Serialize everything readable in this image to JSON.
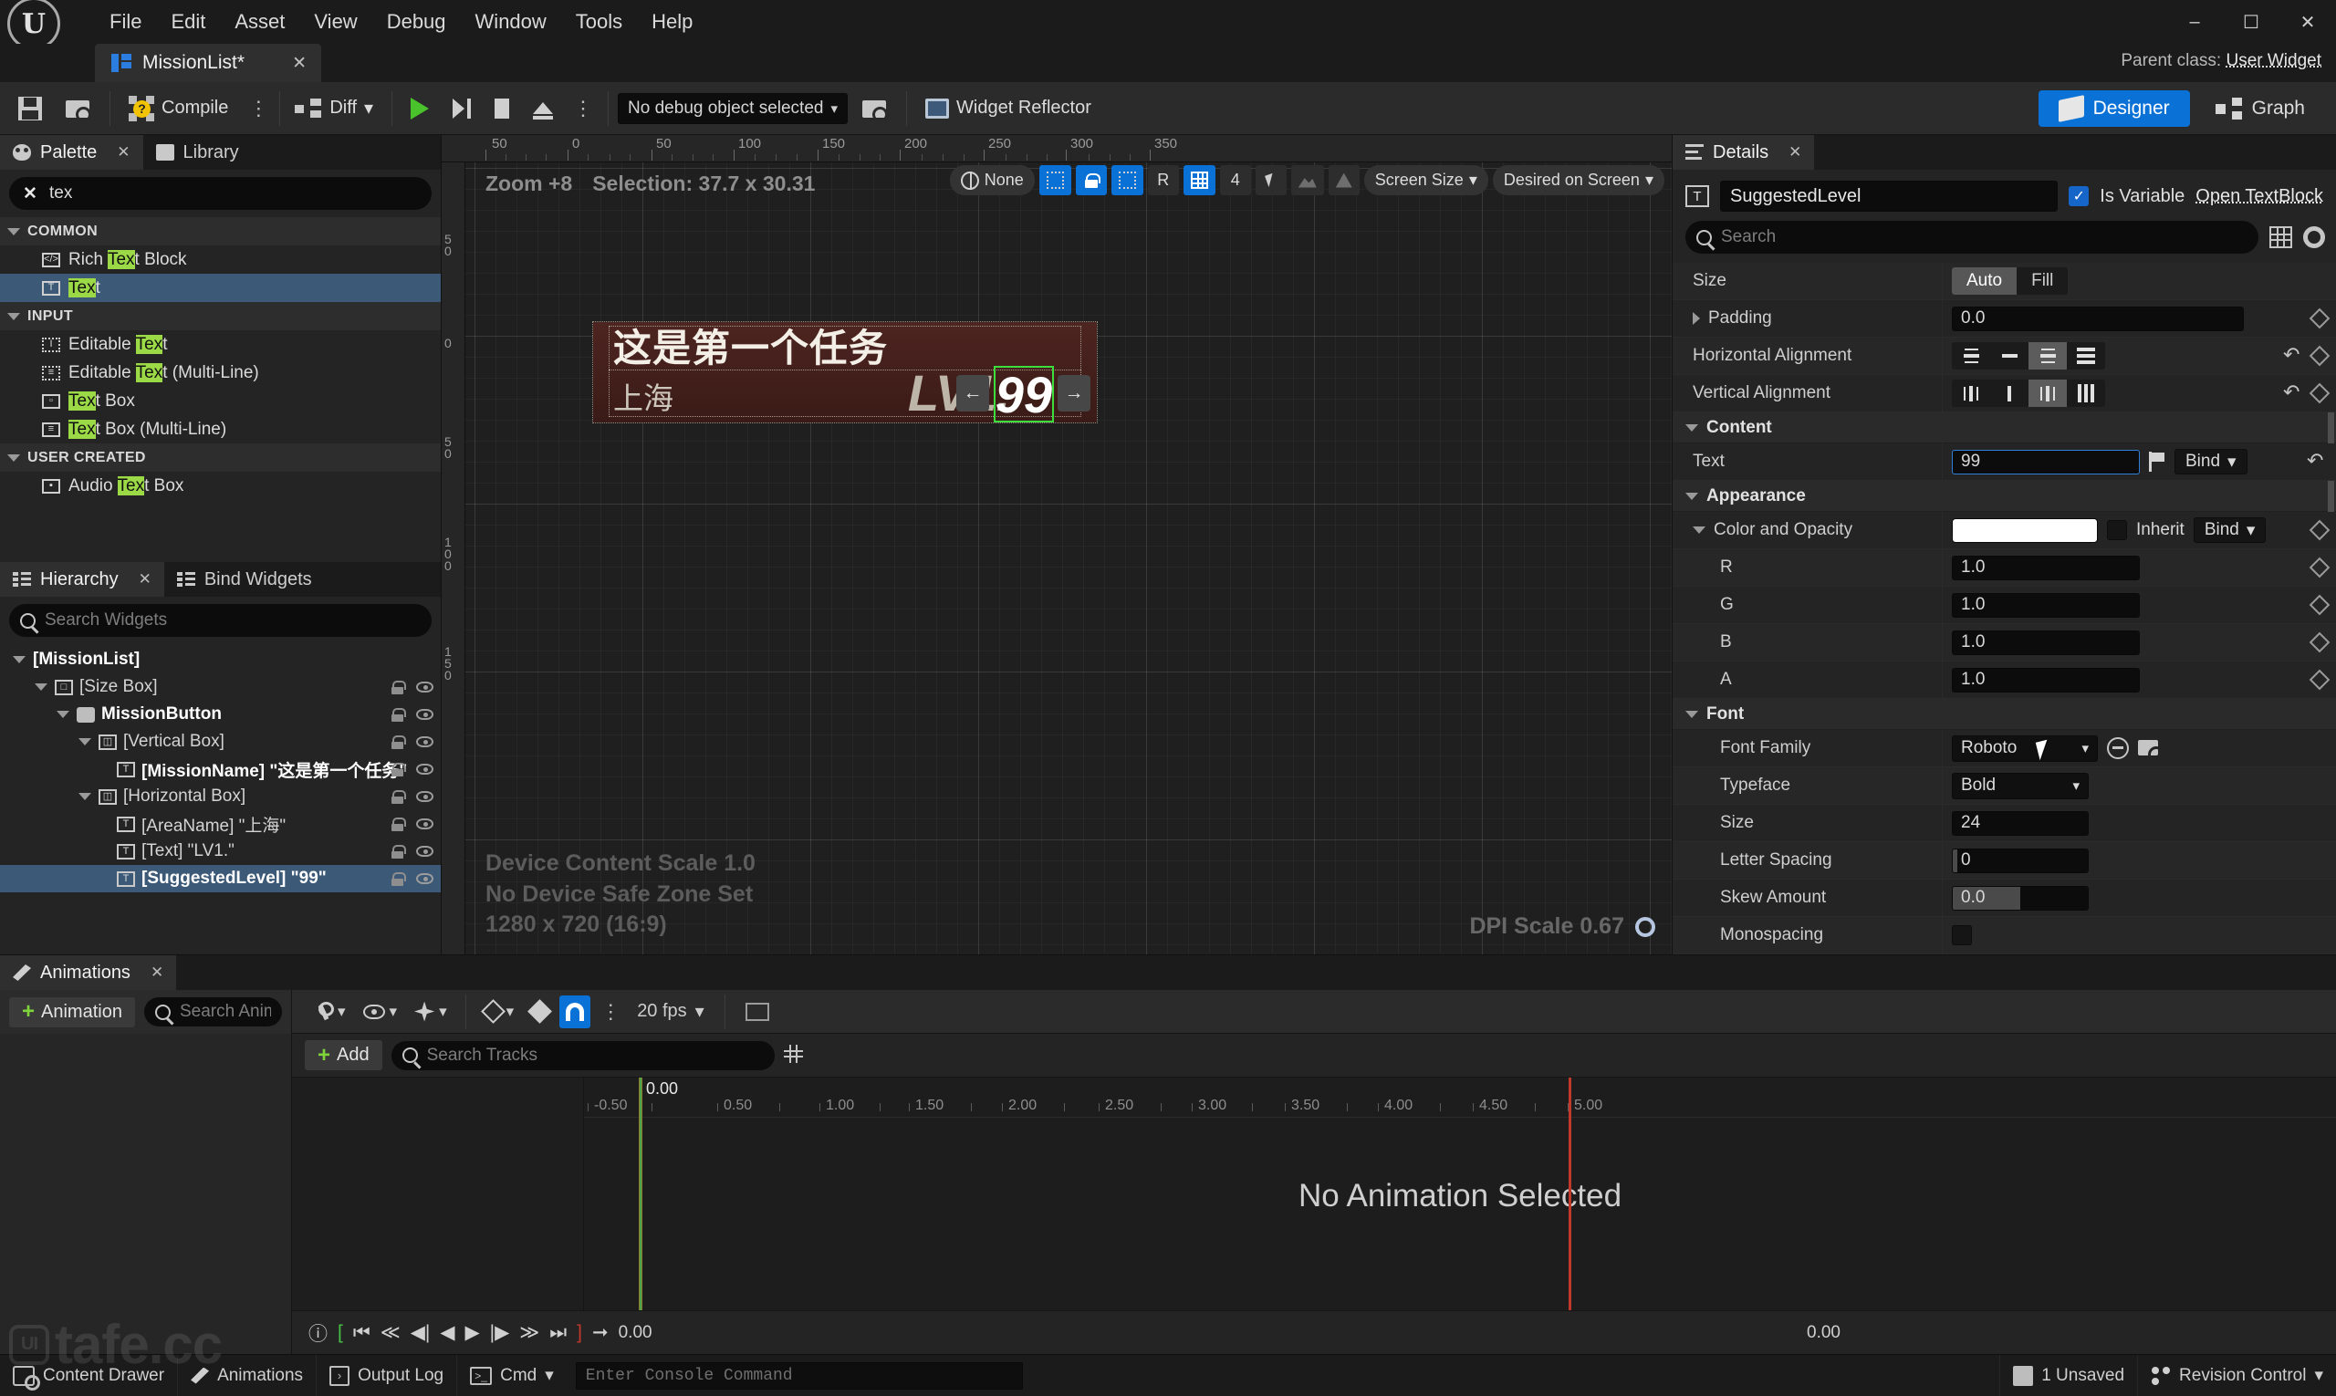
{
  "window": {
    "title": "MissionList*",
    "parent_class_label": "Parent class:",
    "parent_class_value": "User Widget",
    "controls": {
      "minimize": "–",
      "maximize": "☐",
      "close": "✕"
    }
  },
  "menubar": {
    "items": [
      "File",
      "Edit",
      "Asset",
      "View",
      "Debug",
      "Window",
      "Tools",
      "Help"
    ]
  },
  "toolbar": {
    "save_tooltip": "Save",
    "browse_tooltip": "Browse",
    "compile_label": "Compile",
    "diff_label": "Diff",
    "debug_object": "No debug object selected",
    "widget_reflector": "Widget Reflector",
    "mode_designer": "Designer",
    "mode_graph": "Graph"
  },
  "palette": {
    "tab_label": "Palette",
    "library_tab_label": "Library",
    "search_value": "tex",
    "categories": [
      {
        "name": "COMMON",
        "items": [
          {
            "pre": "Rich ",
            "match": "Tex",
            "post": "t Block",
            "icon": "rich-text-icon",
            "selected": false
          },
          {
            "pre": "",
            "match": "Tex",
            "post": "t",
            "icon": "text-icon",
            "selected": true
          }
        ]
      },
      {
        "name": "INPUT",
        "items": [
          {
            "pre": "Editable ",
            "match": "Tex",
            "post": "t",
            "icon": "editable-text-icon",
            "selected": false
          },
          {
            "pre": "Editable ",
            "match": "Tex",
            "post": "t (Multi-Line)",
            "icon": "editable-text-multiline-icon",
            "selected": false
          },
          {
            "pre": "",
            "match": "Tex",
            "post": "t Box",
            "icon": "text-box-icon",
            "selected": false
          },
          {
            "pre": "",
            "match": "Tex",
            "post": "t Box (Multi-Line)",
            "icon": "text-box-multiline-icon",
            "selected": false
          }
        ]
      },
      {
        "name": "USER CREATED",
        "items": [
          {
            "pre": "Audio ",
            "match": "Tex",
            "post": "t Box",
            "icon": "audio-text-box-icon",
            "selected": false
          }
        ]
      }
    ]
  },
  "hierarchy": {
    "tab_label": "Hierarchy",
    "bind_widgets_tab_label": "Bind Widgets",
    "search_placeholder": "Search Widgets",
    "nodes": [
      {
        "depth": 0,
        "label": "[MissionList]",
        "bold": true,
        "expander": "down",
        "icon": "",
        "selected": false
      },
      {
        "depth": 1,
        "label": "[Size Box]",
        "bold": false,
        "expander": "down",
        "icon": "size-box-icon",
        "selected": false
      },
      {
        "depth": 2,
        "label": "MissionButton",
        "bold": true,
        "expander": "down",
        "icon": "button-icon",
        "selected": false
      },
      {
        "depth": 3,
        "label": "[Vertical Box]",
        "bold": false,
        "expander": "down",
        "icon": "vertical-box-icon",
        "selected": false
      },
      {
        "depth": 4,
        "label": "[MissionName] \"这是第一个任务\"",
        "bold": true,
        "expander": "",
        "icon": "text-icon",
        "selected": false
      },
      {
        "depth": 3,
        "label": "[Horizontal Box]",
        "bold": false,
        "expander": "down",
        "icon": "horizontal-box-icon",
        "selected": false
      },
      {
        "depth": 4,
        "label": "[AreaName] \"上海\"",
        "bold": false,
        "expander": "",
        "icon": "text-icon",
        "selected": false
      },
      {
        "depth": 4,
        "label": "[Text] \"LV1.\"",
        "bold": false,
        "expander": "",
        "icon": "text-icon",
        "selected": false
      },
      {
        "depth": 4,
        "label": "[SuggestedLevel] \"99\"",
        "bold": true,
        "expander": "",
        "icon": "text-icon",
        "selected": true
      }
    ]
  },
  "viewport": {
    "zoom_label": "Zoom +8",
    "selection_label": "Selection: 37.7 x 30.31",
    "none_label": "None",
    "grid_snap_value": "4",
    "screen_size_label": "Screen Size",
    "fill_mode_label": "Desired on Screen",
    "device_scale": "Device Content Scale 1.0",
    "safe_zone": "No Device Safe Zone Set",
    "resolution": "1280 x 720 (16:9)",
    "dpi_scale": "DPI Scale 0.67",
    "ruler_h_labels": [
      "50",
      "0",
      "50",
      "100",
      "150",
      "200",
      "250",
      "300",
      "350"
    ],
    "ruler_v_labels": [
      "5 0",
      "0",
      "5 0",
      "1 0 0",
      "1 5 0"
    ],
    "preview": {
      "mission_name": "这是第一个任务",
      "area_name": "上海",
      "level_prefix": "LV1.",
      "level_value": "99",
      "handle_left": "←",
      "handle_right": "→",
      "selection_color": "#3cdd3c"
    }
  },
  "details": {
    "tab_label": "Details",
    "widget_name": "SuggestedLevel",
    "is_variable_label": "Is Variable",
    "is_variable_checked": true,
    "open_textblock_label": "Open TextBlock",
    "search_placeholder": "Search",
    "rows": [
      {
        "type": "prop",
        "label": "Size",
        "kind": "segmented",
        "options": [
          "Auto",
          "Fill"
        ],
        "selected": "Auto"
      },
      {
        "type": "prop",
        "label": "Padding",
        "kind": "text",
        "value": "0.0",
        "expander": "right",
        "diamond": true
      },
      {
        "type": "prop",
        "label": "Horizontal Alignment",
        "kind": "align4",
        "selected_index": 2,
        "undo": true,
        "diamond": true
      },
      {
        "type": "prop",
        "label": "Vertical Alignment",
        "kind": "align4",
        "selected_index": 2,
        "undo": true,
        "diamond": true
      },
      {
        "type": "section",
        "label": "Content"
      },
      {
        "type": "prop",
        "label": "Text",
        "kind": "text-focus",
        "value": "99",
        "bind": "Bind",
        "flag": true,
        "undo": true
      },
      {
        "type": "section",
        "label": "Appearance"
      },
      {
        "type": "prop",
        "label": "Color and Opacity",
        "kind": "color",
        "swatch": "#ffffff",
        "inherit_label": "Inherit",
        "inherit_checked": false,
        "bind": "Bind",
        "expander": "down",
        "diamond": true
      },
      {
        "type": "prop",
        "label": "R",
        "kind": "text",
        "value": "1.0",
        "indent": true,
        "diamond": true
      },
      {
        "type": "prop",
        "label": "G",
        "kind": "text",
        "value": "1.0",
        "indent": true,
        "diamond": true
      },
      {
        "type": "prop",
        "label": "B",
        "kind": "text",
        "value": "1.0",
        "indent": true,
        "diamond": true
      },
      {
        "type": "prop",
        "label": "A",
        "kind": "text",
        "value": "1.0",
        "indent": true,
        "diamond": true
      },
      {
        "type": "section",
        "label": "Font"
      },
      {
        "type": "prop",
        "label": "Font Family",
        "kind": "dropdown-font",
        "value": "Roboto",
        "indent": true
      },
      {
        "type": "prop",
        "label": "Typeface",
        "kind": "dropdown",
        "value": "Bold",
        "indent": true
      },
      {
        "type": "prop",
        "label": "Size",
        "kind": "text",
        "value": "24",
        "indent": true
      },
      {
        "type": "prop",
        "label": "Letter Spacing",
        "kind": "slider",
        "value": "0",
        "fill": 4,
        "indent": true
      },
      {
        "type": "prop",
        "label": "Skew Amount",
        "kind": "slider",
        "value": "0.0",
        "fill": 50,
        "indent": true
      },
      {
        "type": "prop",
        "label": "Monospacing",
        "kind": "checkbox",
        "checked": false,
        "indent": true
      }
    ]
  },
  "animations": {
    "tab_label": "Animations",
    "add_animation_label": "Animation",
    "search_placeholder": "Search Animations",
    "add_track_label": "Add",
    "search_tracks_placeholder": "Search Tracks",
    "fps_label": "20 fps",
    "empty_message": "No Animation Selected",
    "timecode_start": "0.00",
    "timecode_end": "0.00",
    "playhead_label": "0.00",
    "ruler_labels": [
      "-0.50",
      "0.50",
      "1.00",
      "1.50",
      "2.00",
      "2.50",
      "3.00",
      "3.50",
      "4.00",
      "4.50",
      "5.00"
    ]
  },
  "statusbar": {
    "content_drawer": "Content Drawer",
    "animations": "Animations",
    "output_log": "Output Log",
    "cmd": "Cmd",
    "console_placeholder": "Enter Console Command",
    "unsaved": "1 Unsaved",
    "revision_control": "Revision Control"
  },
  "watermark": {
    "text": "tafe.cc"
  }
}
